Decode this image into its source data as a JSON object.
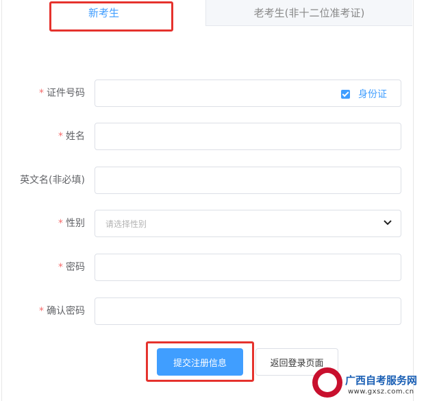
{
  "tabs": {
    "new_candidate": "新考生",
    "old_candidate": "老考生(非十二位准考证)"
  },
  "form": {
    "id_number": {
      "label": "证件号码",
      "required": "*",
      "value": "",
      "id_type_label": "身份证",
      "id_type_checked": true
    },
    "name": {
      "label": "姓名",
      "required": "*",
      "value": ""
    },
    "english_name": {
      "label": "英文名(非必填)",
      "value": ""
    },
    "gender": {
      "label": "性别",
      "required": "*",
      "placeholder": "请选择性别"
    },
    "password": {
      "label": "密码",
      "required": "*",
      "value": ""
    },
    "confirm_password": {
      "label": "确认密码",
      "required": "*",
      "value": ""
    }
  },
  "buttons": {
    "submit": "提交注册信息",
    "back": "返回登录页面"
  },
  "watermark": {
    "site_name": "广西自考服务网",
    "url": "www.gxsz.com.cn"
  },
  "colors": {
    "accent": "#409eff",
    "highlight_box": "#e5322d",
    "required_mark": "#f56c6c"
  }
}
